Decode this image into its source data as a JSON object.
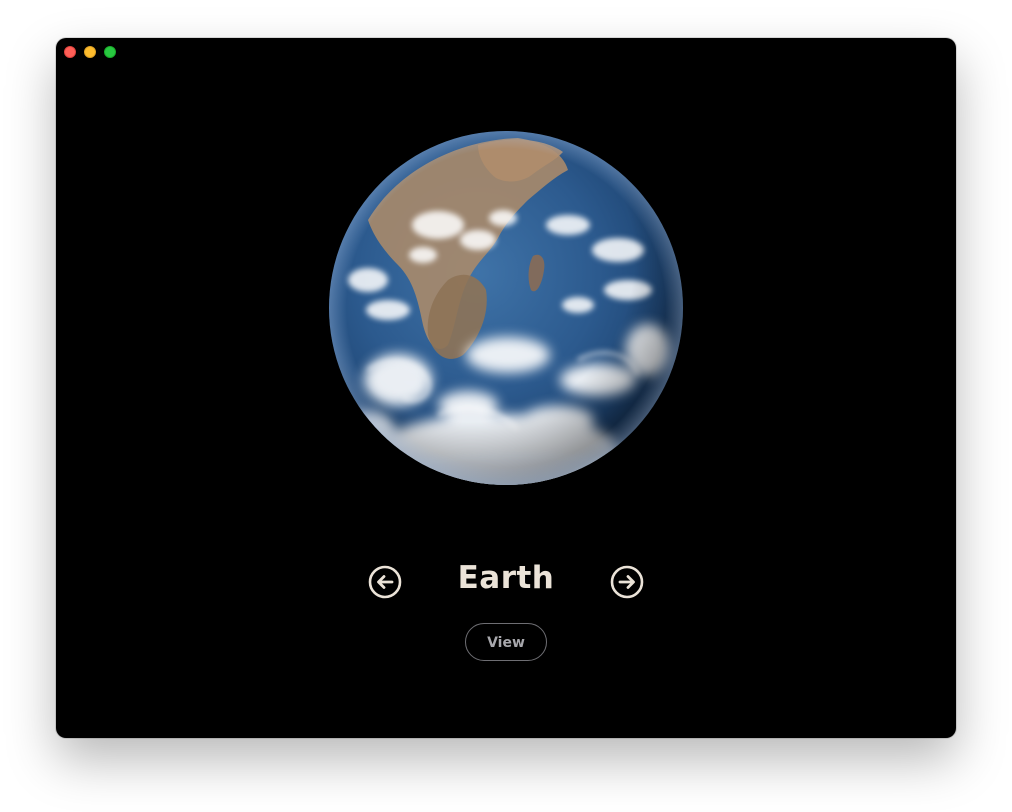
{
  "window": {
    "controls": [
      "close",
      "minimize",
      "zoom"
    ]
  },
  "planet": {
    "name": "Earth",
    "image_icon": "earth-globe-image"
  },
  "navigation": {
    "prev_icon": "arrow-left-circle-icon",
    "next_icon": "arrow-right-circle-icon"
  },
  "actions": {
    "view_label": "View"
  },
  "colors": {
    "background": "#000000",
    "title": "#ebe3d8",
    "button_text": "#a8a8ad",
    "button_border": "#6e6e73",
    "close": "#ff5f57",
    "minimize": "#febc2e",
    "zoom": "#28c840"
  }
}
